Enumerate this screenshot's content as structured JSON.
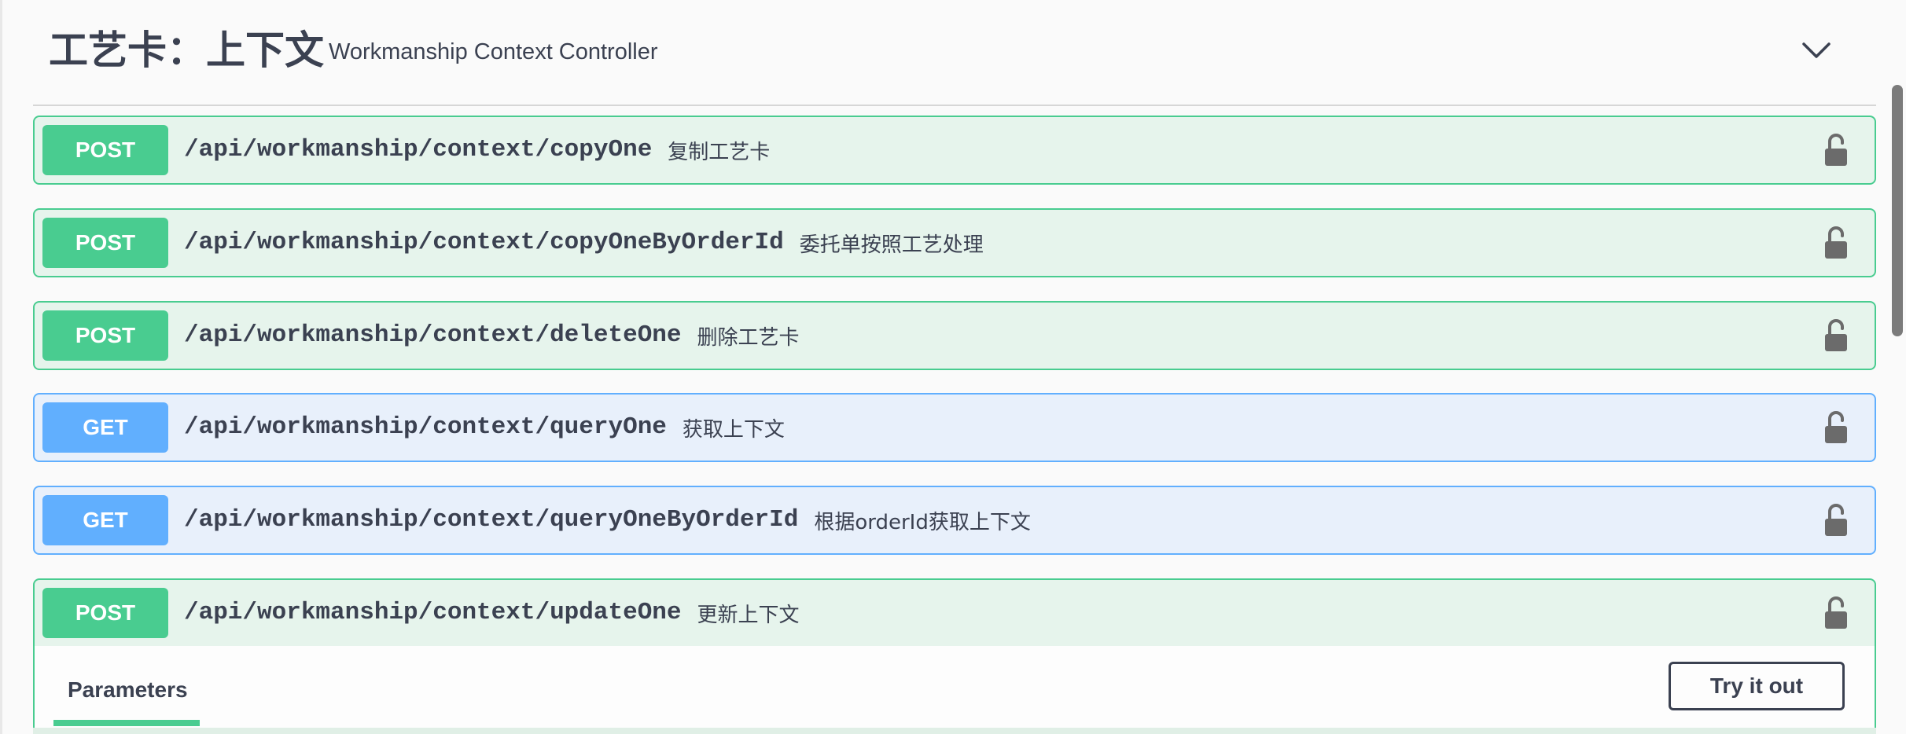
{
  "tag": {
    "title": "工艺卡：上下文",
    "description": "Workmanship Context Controller"
  },
  "operations": [
    {
      "method": "POST",
      "path": "/api/workmanship/context/copyOne",
      "summary": "复制工艺卡"
    },
    {
      "method": "POST",
      "path": "/api/workmanship/context/copyOneByOrderId",
      "summary": "委托单按照工艺处理"
    },
    {
      "method": "POST",
      "path": "/api/workmanship/context/deleteOne",
      "summary": "删除工艺卡"
    },
    {
      "method": "GET",
      "path": "/api/workmanship/context/queryOne",
      "summary": "获取上下文"
    },
    {
      "method": "GET",
      "path": "/api/workmanship/context/queryOneByOrderId",
      "summary": "根据orderId获取上下文"
    },
    {
      "method": "POST",
      "path": "/api/workmanship/context/updateOne",
      "summary": "更新上下文"
    }
  ],
  "expanded": {
    "tab_label": "Parameters",
    "try_button_label": "Try it out"
  },
  "colors": {
    "post": "#49cc90",
    "get": "#61affe",
    "text": "#3b4151"
  }
}
